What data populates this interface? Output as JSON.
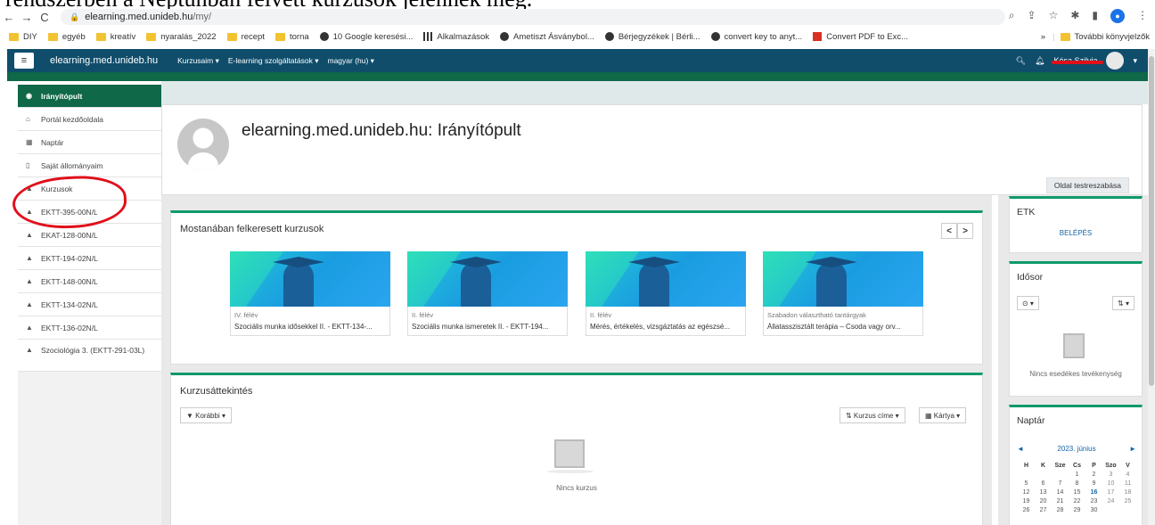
{
  "caption": "rendszerben a Neptunban felvett kurzusok jelennek meg.",
  "browser": {
    "url_host": "elearning.med.unideb.hu",
    "url_path": "/my/",
    "nav_back": "←",
    "nav_forward": "→",
    "nav_reload": "C",
    "bookmarks": [
      {
        "label": "DIY",
        "icon": "folder"
      },
      {
        "label": "egyéb",
        "icon": "folder"
      },
      {
        "label": "kreatív",
        "icon": "folder"
      },
      {
        "label": "nyaralás_2022",
        "icon": "folder"
      },
      {
        "label": "recept",
        "icon": "folder"
      },
      {
        "label": "torna",
        "icon": "folder"
      },
      {
        "label": "10 Google keresési...",
        "icon": "globe"
      },
      {
        "label": "Alkalmazások",
        "icon": "grid"
      },
      {
        "label": "Ametiszt Ásványbol...",
        "icon": "globe"
      },
      {
        "label": "Bérjegyzékek | Bérli...",
        "icon": "globe"
      },
      {
        "label": "convert key to anyt...",
        "icon": "globe"
      },
      {
        "label": "Convert PDF to Exc...",
        "icon": "pdf"
      }
    ],
    "more_bookmarks": "»",
    "other_bookmarks": "További könyvjelzők"
  },
  "navbar": {
    "site_name": "elearning.med.unideb.hu",
    "menu": [
      "Kurzusaim ▾",
      "E-learning szolgáltatások ▾",
      "magyar (hu) ▾"
    ],
    "user_name": "Kósa Szilvia"
  },
  "drawer": {
    "items": [
      {
        "label": "Irányítópult",
        "icon": "dashboard-icon",
        "active": true
      },
      {
        "label": "Portál kezdőoldala",
        "icon": "home-icon"
      },
      {
        "label": "Naptár",
        "icon": "calendar-icon"
      },
      {
        "label": "Saját állományaim",
        "icon": "file-icon"
      },
      {
        "label": "Kurzusok",
        "icon": "graduation-cap-icon"
      },
      {
        "label": "EKTT-395-00N/L",
        "icon": "graduation-cap-icon"
      },
      {
        "label": "EKAT-128-00N/L",
        "icon": "graduation-cap-icon"
      },
      {
        "label": "EKTT-194-02N/L",
        "icon": "graduation-cap-icon"
      },
      {
        "label": "EKTT-148-00N/L",
        "icon": "graduation-cap-icon"
      },
      {
        "label": "EKTT-134-02N/L",
        "icon": "graduation-cap-icon"
      },
      {
        "label": "EKTT-136-02N/L",
        "icon": "graduation-cap-icon"
      },
      {
        "label": "Szociológia 3. (EKTT-291-03L)",
        "icon": "graduation-cap-icon"
      }
    ]
  },
  "header": {
    "title": "elearning.med.unideb.hu: Irányítópult",
    "customize_button": "Oldal testreszabása"
  },
  "recent": {
    "title": "Mostanában felkeresett kurzusok",
    "prev": "<",
    "next": ">",
    "courses": [
      {
        "semester": "IV. félév",
        "name": "Szociális munka idősekkel II. - EKTT-134-..."
      },
      {
        "semester": "II. félév",
        "name": "Szociális munka ismeretek II. - EKTT-194..."
      },
      {
        "semester": "II. félév",
        "name": "Mérés, értékelés, vizsgáztatás az egészsé..."
      },
      {
        "semester": "Szabadon választható tantárgyak",
        "name": "Állatasszisztált terápia – Csoda vagy orv..."
      }
    ]
  },
  "overview": {
    "title": "Kurzusáttekintés",
    "filter_button": "▼ Korábbi ▾",
    "sort_button": "⇅ Kurzus címe ▾",
    "view_button": "▦ Kártya ▾",
    "empty_text": "Nincs kurzus"
  },
  "etk": {
    "title": "ETK",
    "link": "BELÉPÉS"
  },
  "timeline": {
    "title": "Idősor",
    "filter_button": "⊙ ▾",
    "sort_button": "⇅ ▾",
    "empty_text": "Nincs esedékes tevékenység"
  },
  "calendar": {
    "title": "Naptár",
    "prev": "◄",
    "next": "►",
    "month": "2023. június",
    "weekdays": [
      "H",
      "K",
      "Sze",
      "Cs",
      "P",
      "Szo",
      "V"
    ],
    "weeks": [
      [
        "",
        "",
        "",
        "1",
        "2",
        "3",
        "4"
      ],
      [
        "5",
        "6",
        "7",
        "8",
        "9",
        "10",
        "11"
      ],
      [
        "12",
        "13",
        "14",
        "15",
        "16",
        "17",
        "18"
      ],
      [
        "19",
        "20",
        "21",
        "22",
        "23",
        "24",
        "25"
      ],
      [
        "26",
        "27",
        "28",
        "29",
        "30",
        "",
        ""
      ]
    ],
    "today": "16"
  }
}
